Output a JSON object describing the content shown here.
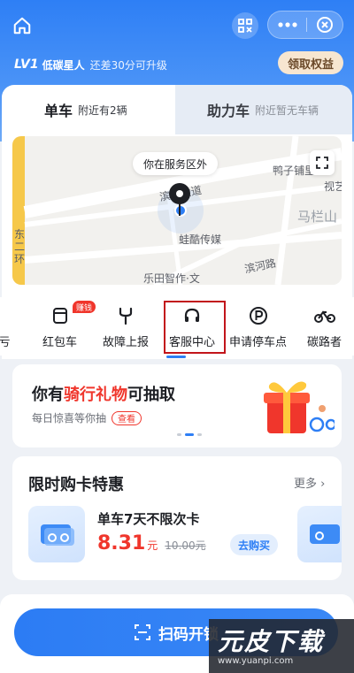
{
  "header": {
    "home_icon": "home-icon",
    "scan_icon": "scan-code-icon",
    "more_icon": "more-dots-icon",
    "close_icon": "close-circle-icon",
    "level_badge": "LV1",
    "level_name": "低碳星人",
    "level_hint": "还差30分可升级",
    "claim_label": "领取权益"
  },
  "tabs": [
    {
      "title": "单车",
      "sub": "附近有2辆",
      "active": true
    },
    {
      "title": "助力车",
      "sub": "附近暂无车辆",
      "active": false
    }
  ],
  "map": {
    "bubble": "你在服务区外",
    "labels": [
      "鸭子铺里",
      "滨江大道",
      "蛙酷传媒",
      "乐田智作·文",
      "滨河路",
      "马栏山",
      "东二环",
      "视艺"
    ]
  },
  "services": [
    {
      "label": "亏",
      "icon": "partial-icon"
    },
    {
      "label": "红包车",
      "icon": "redpacket-bike-icon",
      "badge": "赚钱"
    },
    {
      "label": "故障上报",
      "icon": "wrench-icon"
    },
    {
      "label": "客服中心",
      "icon": "headset-icon",
      "highlighted": true
    },
    {
      "label": "申请停车点",
      "icon": "parking-icon"
    },
    {
      "label": "碳路者",
      "icon": "bike-icon"
    }
  ],
  "gift": {
    "title_prefix": "你有",
    "title_highlight": "骑行礼物",
    "title_suffix": "可抽取",
    "subtitle": "每日惊喜等你抽",
    "view_label": "查看"
  },
  "offers": {
    "title": "限时购卡特惠",
    "more_label": "更多",
    "card_name": "单车7天不限次卡",
    "price": "8.31",
    "unit": "元",
    "old_price": "10.00元",
    "buy_label": "去购买"
  },
  "bottom": {
    "scan_label": "扫码开锁"
  },
  "watermark": {
    "logo": "元皮下载",
    "url": "www.yuanpi.com"
  },
  "colors": {
    "primary": "#2e7ff5",
    "accent_red": "#f0362c",
    "highlight_box": "#c2151b"
  }
}
